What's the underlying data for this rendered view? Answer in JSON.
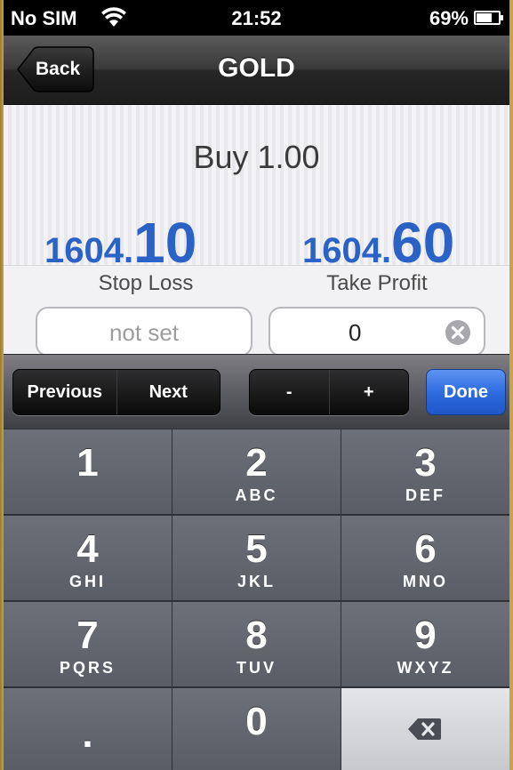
{
  "status_bar": {
    "carrier": "No SIM",
    "time": "21:52",
    "battery_percent": "69%",
    "battery_level": 0.69,
    "wifi_icon": "wifi-icon"
  },
  "nav_bar": {
    "back_label": "Back",
    "title": "GOLD"
  },
  "order": {
    "label": "Buy 1.00",
    "bid": {
      "small": "1604.",
      "big": "10"
    },
    "ask": {
      "small": "1604.",
      "big": "60"
    }
  },
  "form": {
    "stop_loss_label": "Stop Loss",
    "stop_loss_placeholder": "not set",
    "take_profit_label": "Take Profit",
    "take_profit_value": "0"
  },
  "accessory": {
    "previous": "Previous",
    "next": "Next",
    "minus": "-",
    "plus": "+",
    "done": "Done"
  },
  "keypad": {
    "keys": [
      {
        "num": "1",
        "letters": ""
      },
      {
        "num": "2",
        "letters": "ABC"
      },
      {
        "num": "3",
        "letters": "DEF"
      },
      {
        "num": "4",
        "letters": "GHI"
      },
      {
        "num": "5",
        "letters": "JKL"
      },
      {
        "num": "6",
        "letters": "MNO"
      },
      {
        "num": "7",
        "letters": "PQRS"
      },
      {
        "num": "8",
        "letters": "TUV"
      },
      {
        "num": "9",
        "letters": "WXYZ"
      },
      {
        "num": ".",
        "letters": ""
      },
      {
        "num": "0",
        "letters": ""
      }
    ]
  },
  "colors": {
    "price_blue": "#2b62c6",
    "done_blue": "#2e6ce0",
    "key_gray": "#5a5d66"
  }
}
